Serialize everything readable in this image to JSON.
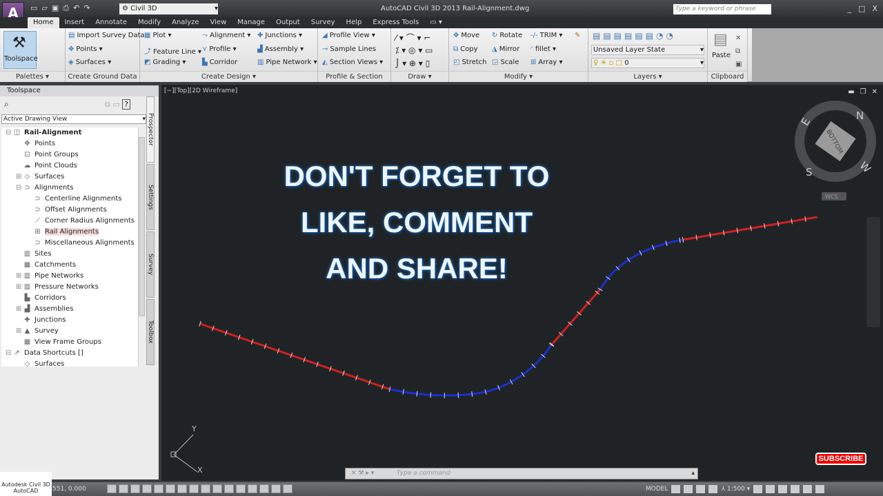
{
  "titlebar": {
    "app_icon": "C3D",
    "title": "AutoCAD Civil 3D 2013   Rail-Alignment.dwg",
    "workspace": "Civil 3D",
    "search_placeholder": "Type a keyword or phrase",
    "window_controls": [
      "_",
      "□",
      "X"
    ],
    "qat": [
      "new",
      "open",
      "save",
      "print",
      "undo",
      "redo"
    ]
  },
  "tabs": [
    "Home",
    "Insert",
    "Annotate",
    "Modify",
    "Analyze",
    "View",
    "Manage",
    "Output",
    "Survey",
    "Help",
    "Express Tools",
    "▭ ▾"
  ],
  "ribbon": {
    "palettes": {
      "title": "Palettes ▾",
      "toolspace": "Toolspace"
    },
    "ground": {
      "title": "Create Ground Data ▾",
      "items": [
        "Import Survey Data",
        "Points ▾",
        "Surfaces ▾"
      ]
    },
    "design": {
      "title": "Create Design ▾",
      "items": [
        "Plot ▾",
        "Feature Line ▾",
        "Grading ▾",
        "Alignment ▾",
        "Profile ▾",
        "Corridor",
        "Junctions ▾",
        "Assembly ▾",
        "Pipe Network ▾"
      ]
    },
    "psv": {
      "title": "Profile & Section Views",
      "items": [
        "Profile View ▾",
        "Sample Lines",
        "Section Views ▾"
      ]
    },
    "draw": {
      "title": "Draw ▾"
    },
    "modify": {
      "title": "Modify ▾",
      "items": [
        "Move",
        "Copy",
        "Stretch",
        "Rotate",
        "Mirror",
        "Scale",
        "TRIM ▾",
        "fillet ▾",
        "Array ▾"
      ]
    },
    "layers": {
      "title": "Layers ▾",
      "layer_state": "Unsaved Layer State",
      "layer": "0"
    },
    "clipboard": {
      "title": "Clipboard",
      "paste": "Paste"
    }
  },
  "toolspace": {
    "title": "Toolspace",
    "view": "Active Drawing View",
    "vtabs": [
      "Prospector",
      "Settings",
      "Survey",
      "Toolbox"
    ],
    "tree": [
      {
        "label": "Rail-Alignment",
        "level": 0,
        "exp": "⊟",
        "bold": true
      },
      {
        "label": "Points",
        "level": 1
      },
      {
        "label": "Point Groups",
        "level": 1
      },
      {
        "label": "Point Clouds",
        "level": 1
      },
      {
        "label": "Surfaces",
        "level": 1,
        "exp": "⊞"
      },
      {
        "label": "Alignments",
        "level": 1,
        "exp": "⊟"
      },
      {
        "label": "Centerline Alignments",
        "level": 2
      },
      {
        "label": "Offset Alignments",
        "level": 2
      },
      {
        "label": "Corner Radius Alignments",
        "level": 2
      },
      {
        "label": "Rail Alignments",
        "level": 2,
        "selected": true
      },
      {
        "label": "Miscellaneous Alignments",
        "level": 2
      },
      {
        "label": "Sites",
        "level": 1
      },
      {
        "label": "Catchments",
        "level": 1
      },
      {
        "label": "Pipe Networks",
        "level": 1,
        "exp": "⊞"
      },
      {
        "label": "Pressure Networks",
        "level": 1,
        "exp": "⊞"
      },
      {
        "label": "Corridors",
        "level": 1
      },
      {
        "label": "Assemblies",
        "level": 1,
        "exp": "⊞"
      },
      {
        "label": "Junctions",
        "level": 1
      },
      {
        "label": "Survey",
        "level": 1,
        "exp": "⊞"
      },
      {
        "label": "View Frame Groups",
        "level": 1
      },
      {
        "label": "Data Shortcuts []",
        "level": 0,
        "exp": "⊟"
      },
      {
        "label": "Surfaces",
        "level": 1
      }
    ]
  },
  "viewport": {
    "label": "[−][Top][2D Wireframe]",
    "viewcube": {
      "face": "BOTTOM",
      "n": "N",
      "e": "E",
      "s": "S",
      "w": "W",
      "wcs": "WCS"
    },
    "ucs_x": "X",
    "ucs_y": "Y"
  },
  "overlay": {
    "line1": "DON'T FORGET TO",
    "line2": "LIKE, COMMENT",
    "line3": "AND SHARE!",
    "subscribe": "SUBSCRIBE"
  },
  "colors": {
    "tangent": "#d02020",
    "curve": "#1a2fd0"
  },
  "command": {
    "placeholder": "Type a command"
  },
  "status": {
    "coords": "551, 0.000",
    "model": "MODEL",
    "scale": "1:500 ▾"
  },
  "logo": {
    "line1": "Autodesk Civil 3D",
    "line2": "AutoCAD"
  }
}
